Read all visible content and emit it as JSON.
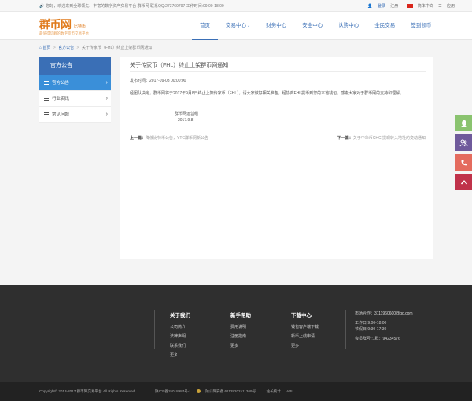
{
  "topbar": {
    "notice": "您好，欢迎来到全球领先、丰富的数字资产交易平台 群币网 联系QQ:273769797 工作时间:09:00-18:00",
    "login": "登录",
    "register": "注册",
    "language": "简体中文",
    "app": "应用"
  },
  "logo": {
    "name": "群币网",
    "sub": "比特币",
    "slogan": "最值得信赖的数字货币交易平台"
  },
  "nav": [
    {
      "label": "首页",
      "active": true
    },
    {
      "label": "交易中心",
      "caret": "⌄"
    },
    {
      "label": "财务中心"
    },
    {
      "label": "安全中心"
    },
    {
      "label": "认购中心"
    },
    {
      "label": "全民交易"
    },
    {
      "label": "签到领币"
    }
  ],
  "breadcrumb": {
    "home": "首页",
    "section": "官方公告",
    "current": "关于传家币（FHL）终止上架群币网通知"
  },
  "sidebar": {
    "title": "官方公告",
    "items": [
      {
        "label": "官方公告",
        "active": true
      },
      {
        "label": "行业资讯"
      },
      {
        "label": "常见问题"
      }
    ]
  },
  "article": {
    "title": "关于传家币（FHL）终止上架群币网通知",
    "time_label": "发布时间：",
    "time": "2017-09-08 00:00:00",
    "body": "经团队决定，群币网将于2017年9月8日终止上架传家币（FHL），请大家做好相关准备，经协商FHL提币到您的本地钱包。感谢大家对于群币网的支持和理解。",
    "sign_team": "群币网运营组",
    "sign_date": "2017.9.8"
  },
  "pager": {
    "prev_label": "上一篇：",
    "prev_title": "降低比特币公告，YTC群币网新公告",
    "next_label": "下一篇：",
    "next_title": "关于中华币CHC 提现转入地址的变动通知"
  },
  "floatbar": {
    "qq": "QQ",
    "users": "客服",
    "phone": "电话",
    "top": "顶部"
  },
  "footer": {
    "cols": [
      {
        "title": "关于我们",
        "links": [
          "公司简介",
          "法律声明",
          "联系我们",
          "更多"
        ]
      },
      {
        "title": "新手帮助",
        "links": [
          "费用说明",
          "注册指南",
          "更多"
        ]
      },
      {
        "title": "下载中心",
        "links": [
          "钱包客户端下载",
          "新币上线申请",
          "更多"
        ]
      }
    ],
    "contact": {
      "email_label": "市场合作：",
      "email": "3111960600@qq.com",
      "hours_line1": "工作日:9:00-18:00",
      "hours_line2": "节假日:9:30-17:30",
      "group": "会员群号 :1群：94234576"
    },
    "copyright": "Copyright© 2013-2017 群币网交易平台 All Rights Reserved",
    "icp": "陕ICP备15018984号-1",
    "police": "陕公网安备 61128202411369号",
    "stats": "站长统计",
    "api": "API"
  },
  "colors": {
    "brand_blue": "#3a6fb6",
    "logo_orange": "#e07b1c",
    "sidebar_active": "#3a8fd9"
  }
}
